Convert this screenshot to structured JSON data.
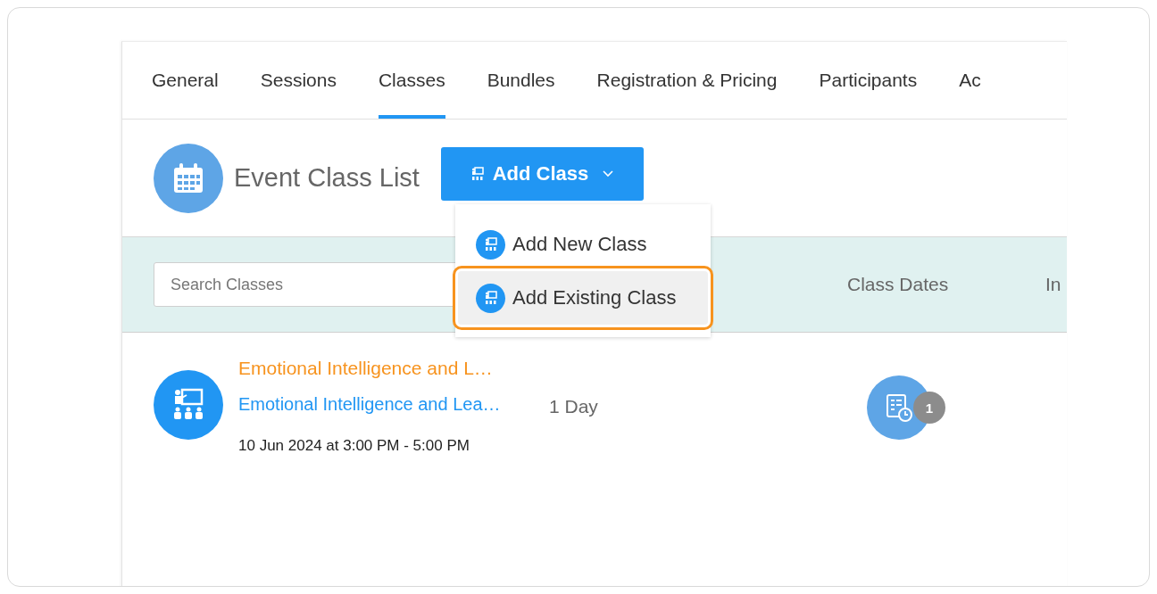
{
  "tabs": [
    {
      "label": "General",
      "selected": false
    },
    {
      "label": "Sessions",
      "selected": false
    },
    {
      "label": "Classes",
      "selected": true
    },
    {
      "label": "Bundles",
      "selected": false
    },
    {
      "label": "Registration & Pricing",
      "selected": false
    },
    {
      "label": "Participants",
      "selected": false
    },
    {
      "label": "Ac",
      "selected": false
    }
  ],
  "header": {
    "title": "Event Class List",
    "add_button": "Add Class"
  },
  "menu": {
    "items": [
      {
        "label": "Add New Class",
        "highlighted": false
      },
      {
        "label": "Add Existing Class",
        "highlighted": true
      }
    ]
  },
  "filter_bar": {
    "search": {
      "placeholder": "Search Classes"
    },
    "columns": [
      "Class Dates",
      "In"
    ]
  },
  "classes": [
    {
      "title": "Emotional Intelligence and L…",
      "subtitle": "Emotional Intelligence and Lea…",
      "duration": "1 Day",
      "schedule": "10 Jun 2024 at 3:00 PM - 5:00 PM",
      "dates_count": "1"
    }
  ]
}
